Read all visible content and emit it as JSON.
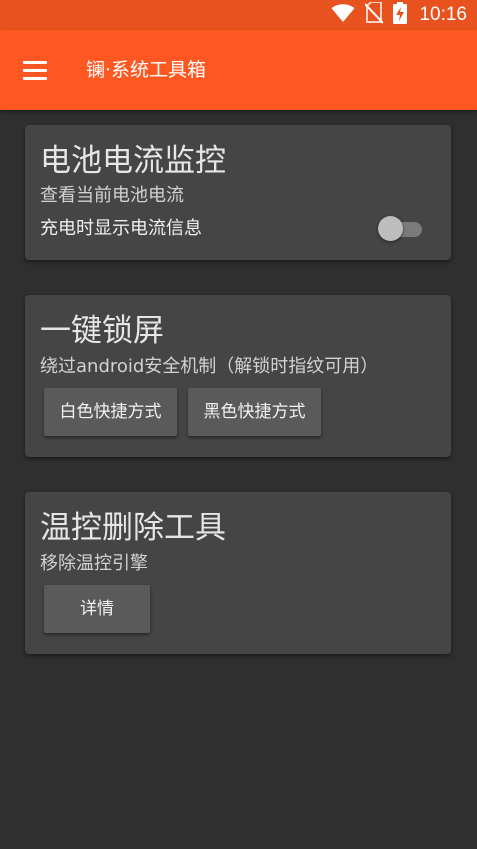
{
  "status_bar": {
    "time": "10:16",
    "icons": [
      "wifi-icon",
      "no-sim-icon",
      "battery-charging-icon"
    ]
  },
  "app_bar": {
    "menu_icon": "hamburger-menu-icon",
    "title": "镧·系统工具箱"
  },
  "cards": {
    "battery": {
      "title": "电池电流监控",
      "description": "查看当前电池电流",
      "switch_label": "充电时显示电流信息",
      "switch_on": false
    },
    "lock": {
      "title": "一键锁屏",
      "description": "绕过android安全机制（解锁时指纹可用）",
      "buttons": [
        "白色快捷方式",
        "黑色快捷方式"
      ]
    },
    "thermal": {
      "title": "温控删除工具",
      "description": "移除温控引擎",
      "button": "详情"
    }
  },
  "colors": {
    "accent": "#ff5722",
    "status_bar": "#e8521e",
    "background": "#2f2f2f",
    "card": "#454545",
    "button": "#5a5a5a"
  }
}
